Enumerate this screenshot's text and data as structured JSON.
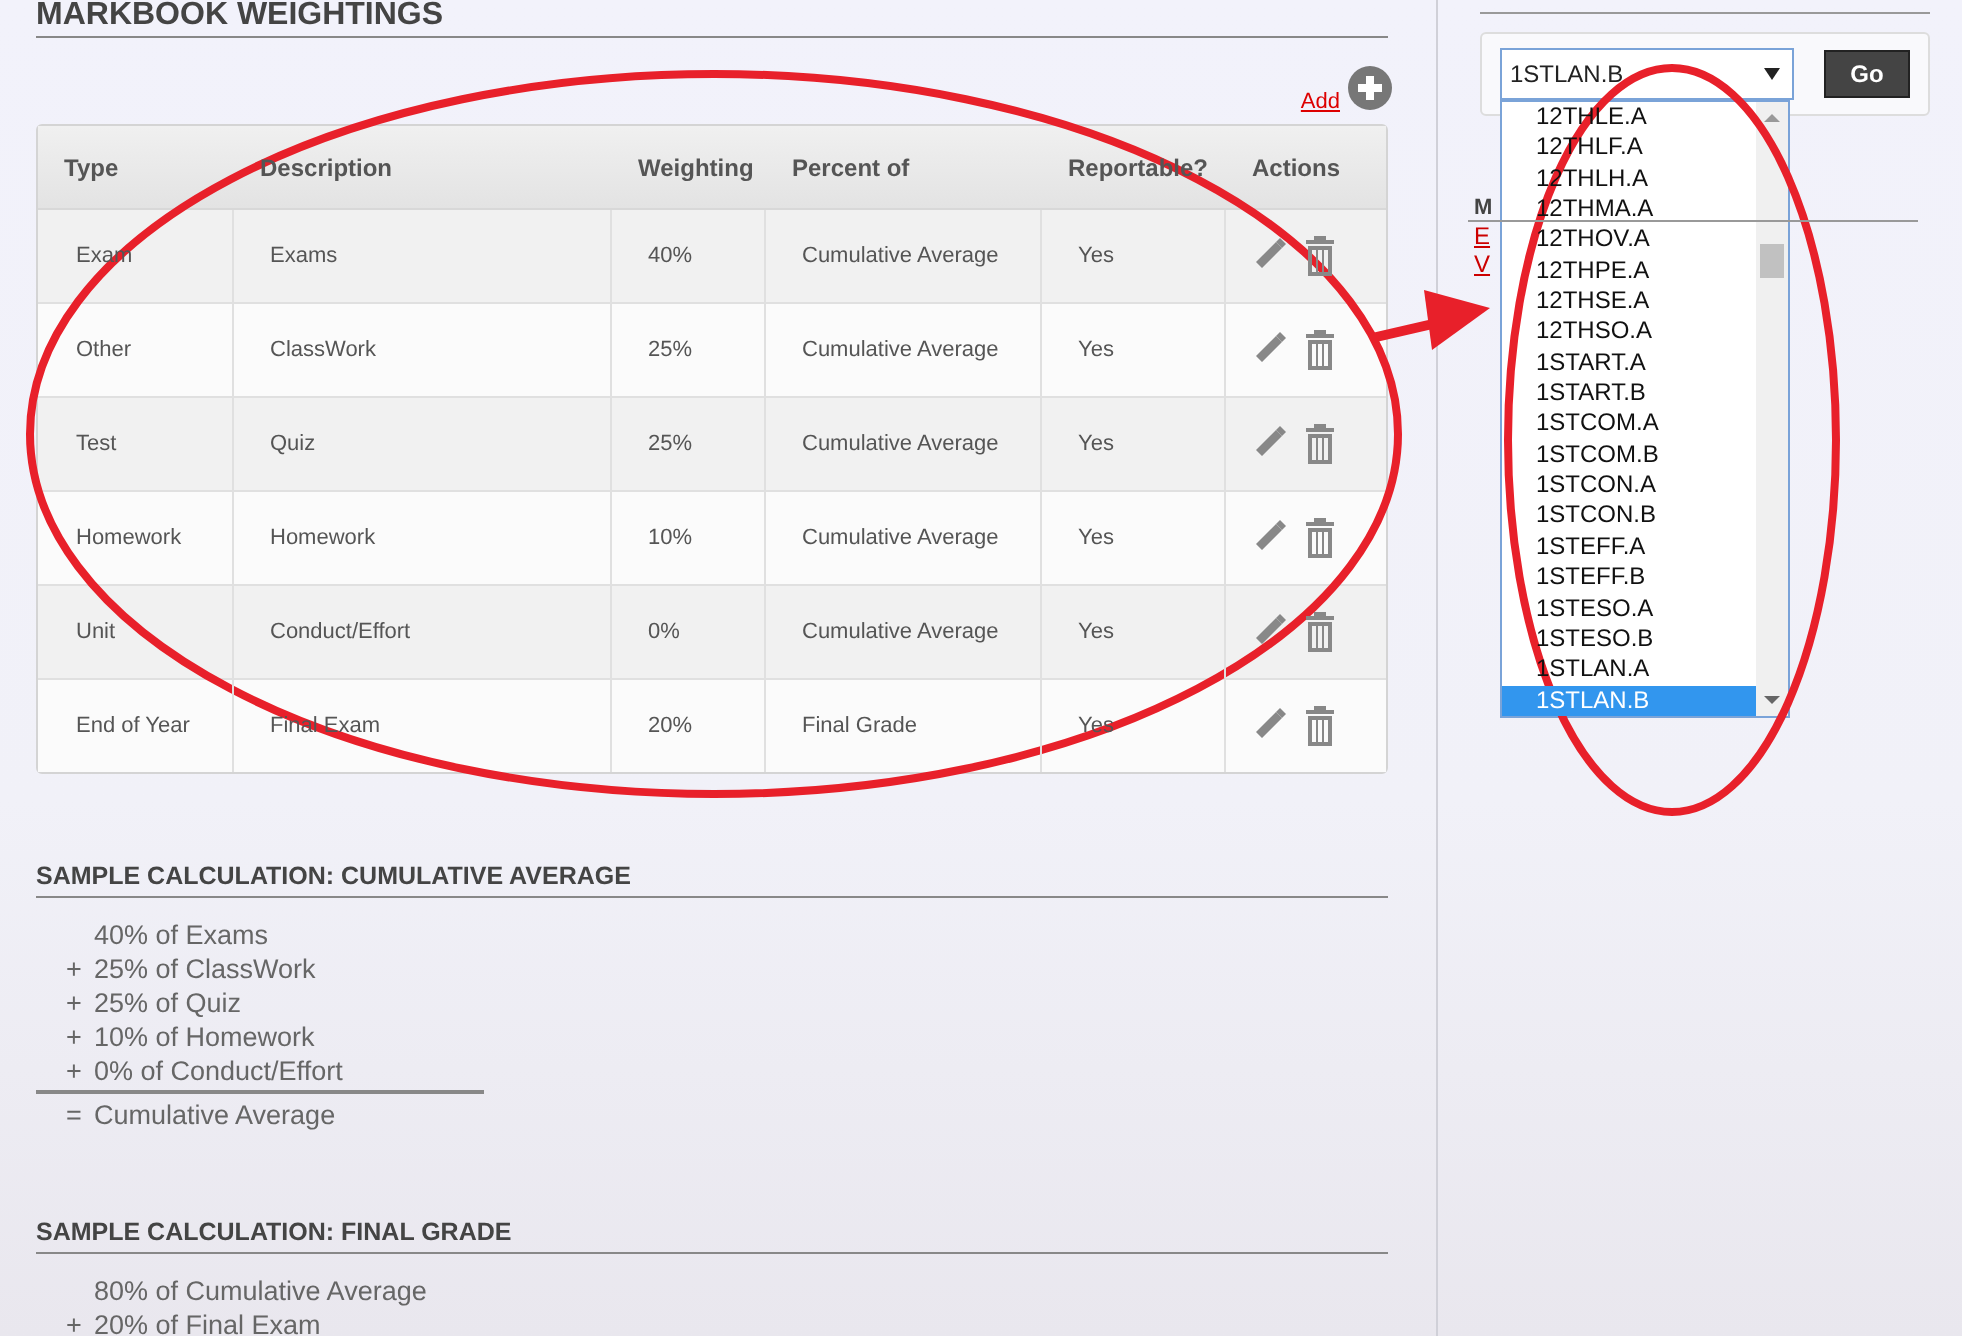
{
  "page_title": "MARKBOOK WEIGHTINGS",
  "add_link": "Add",
  "table": {
    "columns": [
      "Type",
      "Description",
      "Weighting",
      "Percent of",
      "Reportable?",
      "Actions"
    ],
    "rows": [
      {
        "type": "Exam",
        "description": "Exams",
        "weighting": "40%",
        "percent_of": "Cumulative Average",
        "reportable": "Yes"
      },
      {
        "type": "Other",
        "description": "ClassWork",
        "weighting": "25%",
        "percent_of": "Cumulative Average",
        "reportable": "Yes"
      },
      {
        "type": "Test",
        "description": "Quiz",
        "weighting": "25%",
        "percent_of": "Cumulative Average",
        "reportable": "Yes"
      },
      {
        "type": "Homework",
        "description": "Homework",
        "weighting": "10%",
        "percent_of": "Cumulative Average",
        "reportable": "Yes"
      },
      {
        "type": "Unit",
        "description": "Conduct/Effort",
        "weighting": "0%",
        "percent_of": "Cumulative Average",
        "reportable": "Yes"
      },
      {
        "type": "End of Year",
        "description": "Final Exam",
        "weighting": "20%",
        "percent_of": "Final Grade",
        "reportable": "Yes"
      }
    ]
  },
  "calculations": [
    {
      "title": "SAMPLE CALCULATION: CUMULATIVE AVERAGE",
      "lines": [
        {
          "text": "40% of Exams"
        },
        {
          "operator": "+",
          "text": "25% of ClassWork"
        },
        {
          "operator": "+",
          "text": "25% of Quiz"
        },
        {
          "operator": "+",
          "text": "10% of Homework"
        },
        {
          "operator": "+",
          "text": "0% of Conduct/Effort"
        }
      ],
      "result": {
        "operator": "=",
        "text": "Cumulative Average"
      }
    },
    {
      "title": "SAMPLE CALCULATION: FINAL GRADE",
      "lines": [
        {
          "text": "80% of Cumulative Average"
        },
        {
          "operator": "+",
          "text": "20% of Final Exam"
        }
      ]
    }
  ],
  "sidebar": {
    "class_select": {
      "value": "1STLAN.B",
      "expanded": true,
      "options": [
        {
          "label": "12THLE.A",
          "selected": false
        },
        {
          "label": "12THLF.A",
          "selected": false
        },
        {
          "label": "12THLH.A",
          "selected": false
        },
        {
          "label": "12THMA.A",
          "selected": false
        },
        {
          "label": "12THOV.A",
          "selected": false
        },
        {
          "label": "12THPE.A",
          "selected": false
        },
        {
          "label": "12THSE.A",
          "selected": false
        },
        {
          "label": "12THSO.A",
          "selected": false
        },
        {
          "label": "1START.A",
          "selected": false
        },
        {
          "label": "1START.B",
          "selected": false
        },
        {
          "label": "1STCOM.A",
          "selected": false
        },
        {
          "label": "1STCOM.B",
          "selected": false
        },
        {
          "label": "1STCON.A",
          "selected": false
        },
        {
          "label": "1STCON.B",
          "selected": false
        },
        {
          "label": "1STEFF.A",
          "selected": false
        },
        {
          "label": "1STEFF.B",
          "selected": false
        },
        {
          "label": "1STESO.A",
          "selected": false
        },
        {
          "label": "1STESO.B",
          "selected": false
        },
        {
          "label": "1STLAN.A",
          "selected": false
        },
        {
          "label": "1STLAN.B",
          "selected": true
        }
      ]
    },
    "go_button": "Go",
    "section_heading": "M",
    "links": [
      "E",
      "V"
    ]
  }
}
